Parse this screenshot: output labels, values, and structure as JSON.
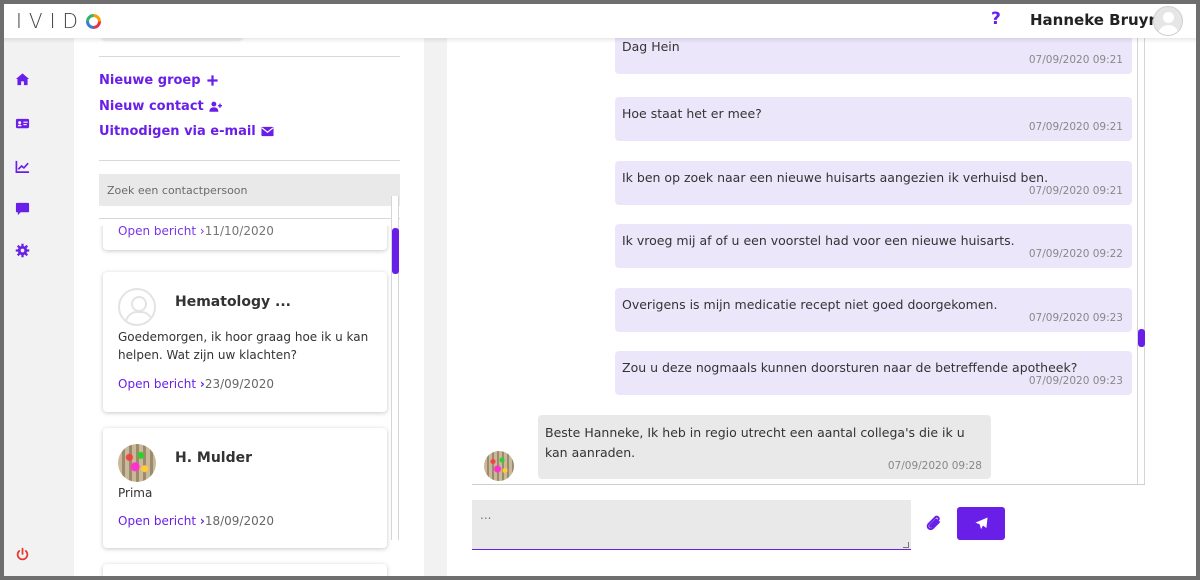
{
  "app": {
    "logo_text": "IVID",
    "help_label": "?",
    "user_name": "Hanneke Bruyn"
  },
  "nav": {
    "items": [
      {
        "icon": "home-icon"
      },
      {
        "icon": "contact-card-icon"
      },
      {
        "icon": "chart-line-icon"
      },
      {
        "icon": "chat-icon"
      },
      {
        "icon": "gear-icon"
      }
    ],
    "logout_icon": "power-icon"
  },
  "colors": {
    "accent": "#6a1fe8",
    "outgoing_bubble": "#ece6fb",
    "incoming_bubble": "#e9e9e9",
    "logout": "#e53935"
  },
  "contacts": {
    "actions": {
      "new_group": "Nieuwe groep",
      "new_contact": "Nieuw contact",
      "invite_email": "Uitnodigen via e-mail"
    },
    "search_placeholder": "Zoek een contactpersoon",
    "peek": {
      "open_label": "Open bericht",
      "date": "11/10/2020"
    },
    "cards": [
      {
        "name": "Hematology ...",
        "message": "Goedemorgen, ik hoor graag hoe ik u kan helpen. Wat zijn uw klachten?",
        "open_label": "Open bericht",
        "date": "23/09/2020"
      },
      {
        "name": "H. Mulder",
        "message": "Prima",
        "open_label": "Open bericht",
        "date": "18/09/2020"
      }
    ]
  },
  "chat": {
    "messages_out": [
      {
        "text": "Dag Hein",
        "time": "07/09/2020 09:21"
      },
      {
        "text": "Hoe staat het er mee?",
        "time": "07/09/2020 09:21"
      },
      {
        "text": "Ik ben op zoek naar een nieuwe huisarts aangezien ik verhuisd ben.",
        "time": "07/09/2020 09:21"
      },
      {
        "text": "Ik vroeg mij af of u een voorstel had voor een nieuwe huisarts.",
        "time": "07/09/2020 09:22"
      },
      {
        "text": "Overigens is mijn medicatie recept niet goed doorgekomen.",
        "time": "07/09/2020 09:23"
      },
      {
        "text": "Zou u deze nogmaals kunnen doorsturen naar de betreffende apotheek?",
        "time": "07/09/2020 09:23"
      }
    ],
    "message_in": {
      "text": "Beste Hanneke, Ik heb in regio utrecht een aantal collega's die ik u kan aanraden.",
      "time": "07/09/2020 09:28"
    },
    "composer_placeholder": "...",
    "attach_icon": "paperclip-icon",
    "send_icon": "send-icon"
  }
}
